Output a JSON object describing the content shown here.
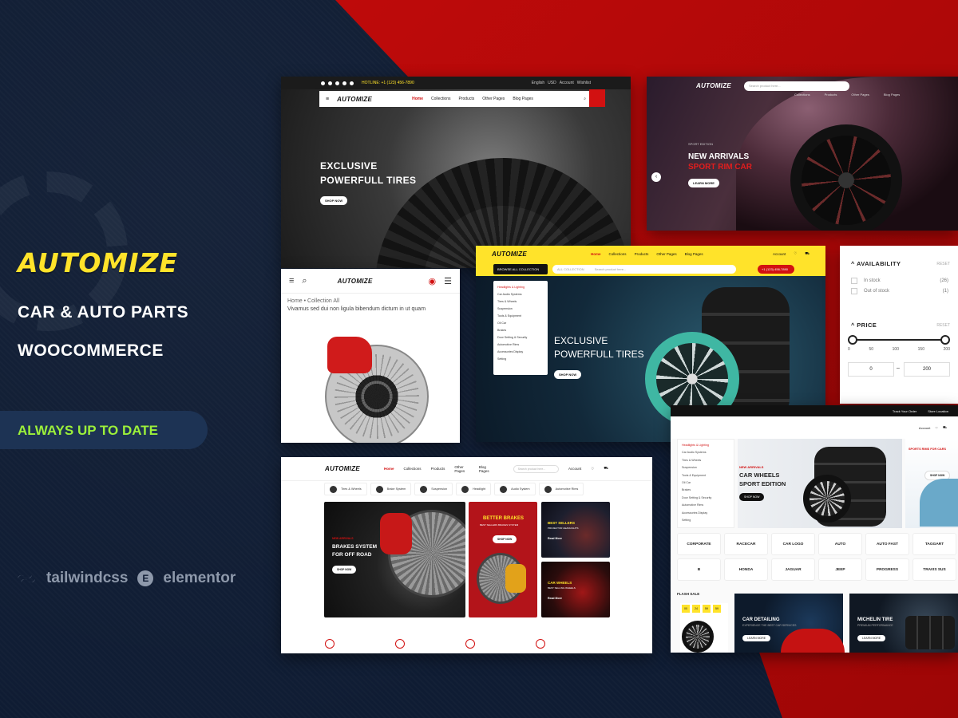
{
  "brand": {
    "logo": "AUTOMIZE",
    "line1": "CAR & AUTO PARTS",
    "line2": "WOOCOMMERCE",
    "badge": "ALWAYS UP TO DATE",
    "tech": [
      "tailwindcss",
      "elementor"
    ]
  },
  "colors": {
    "accent_yellow": "#ffe32a",
    "accent_red": "#d21111",
    "navy": "#0f1c33",
    "badge_green": "#9cf03a"
  },
  "panel1": {
    "hotline": "HOTLINE: +1 (123) 456-7890",
    "lang": "English",
    "currency": "USD",
    "account": "Account",
    "wishlist": "Wishlist",
    "logo": "AUTOMIZE",
    "nav": [
      "Home",
      "Collections",
      "Products",
      "Other Pages",
      "Blog Pages"
    ],
    "hero_1": "EXCLUSIVE",
    "hero_2": "POWERFULL TIRES",
    "btn": "SHOP NOW"
  },
  "panel2": {
    "logo": "AUTOMIZE",
    "search_placeholder": "Search product here...",
    "menu": [
      "Collections",
      "Products",
      "Other Pages",
      "Blog Pages"
    ],
    "eyebrow": "SPORT EDITION",
    "h1": "NEW ARRIVALS",
    "h2": "SPORT RIM CAR",
    "btn": "LEARN MORE"
  },
  "panel3": {
    "logo": "AUTOMIZE",
    "crumb_home": "Home",
    "crumb_sep": "•",
    "crumb_collection": "Collection All",
    "product_title": "Vivamus sed dui non ligula bibendum dictum in ut quam"
  },
  "panel4": {
    "logo": "AUTOMIZE",
    "nav": [
      "Home",
      "Collections",
      "Products",
      "Other Pages",
      "Blog Pages"
    ],
    "account": "Account",
    "browse": "BROWSE ALL COLLECTION",
    "all_collection": "ALL COLLECTION",
    "search_placeholder": "Search product here...",
    "phone": "+1 (123) 456-7890",
    "categories": [
      "Headlights & Lighting",
      "Car Audio Systems",
      "Tires & Wheels",
      "Suspension",
      "Tools & Equipment",
      "Oil Car",
      "Brakes",
      "Door Setting & Security",
      "Automotive Rims",
      "Accessories Display",
      "Setting"
    ],
    "hero_1": "EXCLUSIVE",
    "hero_2": "POWERFULL TIRES",
    "btn": "SHOP NOW"
  },
  "panel5": {
    "availability": "AVAILABILITY",
    "reset": "RESET",
    "in_stock": "In stock",
    "in_stock_count": "(26)",
    "out_of_stock": "Out of stock",
    "out_of_stock_count": "(1)",
    "price": "PRICE",
    "ticks": [
      "0",
      "50",
      "100",
      "150",
      "200"
    ],
    "min": "0",
    "dash": "–",
    "max": "200",
    "range": [
      0,
      200
    ]
  },
  "panel6": {
    "logo": "AUTOMIZE",
    "nav": [
      "Home",
      "Collections",
      "Products",
      "Other Pages",
      "Blog Pages"
    ],
    "search_placeholder": "Search product here...",
    "account": "Account",
    "categories": [
      "Tires & Wheels",
      "Brake System",
      "Suspension",
      "Headlight",
      "Audio System",
      "Automotive Rims"
    ],
    "card1_eyebrow": "NEW ARRIVALS",
    "card1_h1": "BRAKES SYSTEM",
    "card1_h2": "FOR OFF ROAD",
    "card1_btn": "SHOP NOW",
    "card2_h": "BETTER BRAKES",
    "card2_sub": "BEST SELLERS BRAKES SYSTEM",
    "card2_btn": "SHOP NOW",
    "card3_h": "BEST SELLERS",
    "card3_sub": "PROJECTOR HEADLIGHTS",
    "card3_link": "Read More",
    "card4_h": "CAR WHEELS",
    "card4_sub": "BEST SELLING WHEELS",
    "card4_link": "Read More"
  },
  "panel7": {
    "top": [
      "Track Your Order",
      "Store Location"
    ],
    "account": "Account",
    "categories": [
      "Headlights & Lighting",
      "Car Audio Systems",
      "Tires & Wheels",
      "Suspension",
      "Tools & Equipment",
      "Oil Car",
      "Brakes",
      "Door Setting & Security",
      "Automotive Rims",
      "Accessories Display",
      "Setting"
    ],
    "slide_eyebrow": "NEW ARRIVALS",
    "slide_h1": "CAR WHEELS",
    "slide_h2": "SPORT EDITION",
    "slide_btn": "SHOP NOW",
    "side_title": "SPORTS RIMS FOR CARS",
    "side_btn": "SHOP NOW",
    "brands": [
      "CORPORATE",
      "RACECAR",
      "CAR LOGO",
      "AUTO",
      "AUTO FAST",
      "TAGGART",
      "B",
      "HONDA",
      "JAGUAR",
      "JEEP",
      "PROGRESS",
      "TRAVIS SUS"
    ],
    "flash": "FLASH SALE",
    "counters": [
      "00",
      "24",
      "59",
      "59"
    ],
    "promo1_h": "CAR DETAILING",
    "promo1_sub": "EXPERIENCE THE BEST CAR SERVICES",
    "promo1_btn": "LEARN MORE",
    "promo2_h": "MICHELIN TIRE",
    "promo2_sub": "PREMIUM PERFORMANCE",
    "promo2_btn": "LEARN MORE"
  }
}
